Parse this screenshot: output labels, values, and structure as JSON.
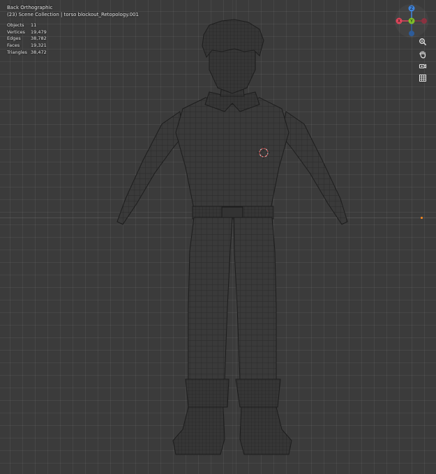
{
  "viewport": {
    "view_name": "Back Orthographic",
    "collection_line": "(23) Scene Collection | torso blockout_Retopology.001",
    "stats": [
      {
        "label": "Objects",
        "value": "11"
      },
      {
        "label": "Vertices",
        "value": "19,479"
      },
      {
        "label": "Edges",
        "value": "38,782"
      },
      {
        "label": "Faces",
        "value": "19,321"
      },
      {
        "label": "Triangles",
        "value": "38,472"
      }
    ]
  },
  "gizmo": {
    "z_label": "Z",
    "x_label": "X",
    "y_label": "Y",
    "colors": {
      "x": "#e0455a",
      "y": "#7fbf2a",
      "z": "#3f84db"
    }
  },
  "nav_buttons": [
    "zoom-icon",
    "hand-pan-icon",
    "camera-icon",
    "grid-icon"
  ]
}
